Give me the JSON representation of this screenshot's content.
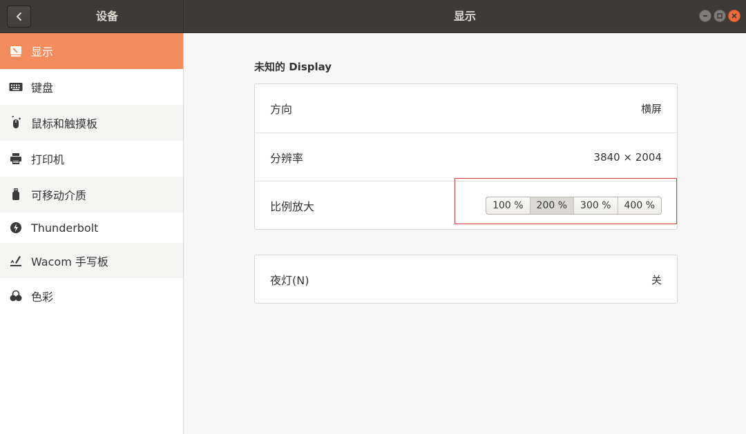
{
  "header": {
    "left_title": "设备",
    "title": "显示"
  },
  "sidebar": {
    "items": [
      {
        "label": "显示",
        "icon": "display-icon",
        "active": true
      },
      {
        "label": "键盘",
        "icon": "keyboard-icon"
      },
      {
        "label": "鼠标和触摸板",
        "icon": "mouse-icon"
      },
      {
        "label": "打印机",
        "icon": "printer-icon"
      },
      {
        "label": "可移动介质",
        "icon": "usb-icon"
      },
      {
        "label": "Thunderbolt",
        "icon": "thunderbolt-icon"
      },
      {
        "label": "Wacom 手写板",
        "icon": "tablet-icon"
      },
      {
        "label": "色彩",
        "icon": "color-icon"
      }
    ]
  },
  "main": {
    "section_title": "未知的 Display",
    "rows": [
      {
        "label": "方向",
        "value": "横屏"
      },
      {
        "label": "分辨率",
        "value": "3840 × 2004"
      },
      {
        "label": "比例放大"
      }
    ],
    "scale_options": [
      "100 %",
      "200 %",
      "300 %",
      "400 %"
    ],
    "scale_selected": "200 %",
    "night_light": {
      "label": "夜灯(N)",
      "value": "关"
    }
  },
  "colors": {
    "accent": "#f58c5d",
    "headerbar": "#3c3b37",
    "highlight_border": "#e23b3b",
    "close_button": "#ef6a3d"
  }
}
